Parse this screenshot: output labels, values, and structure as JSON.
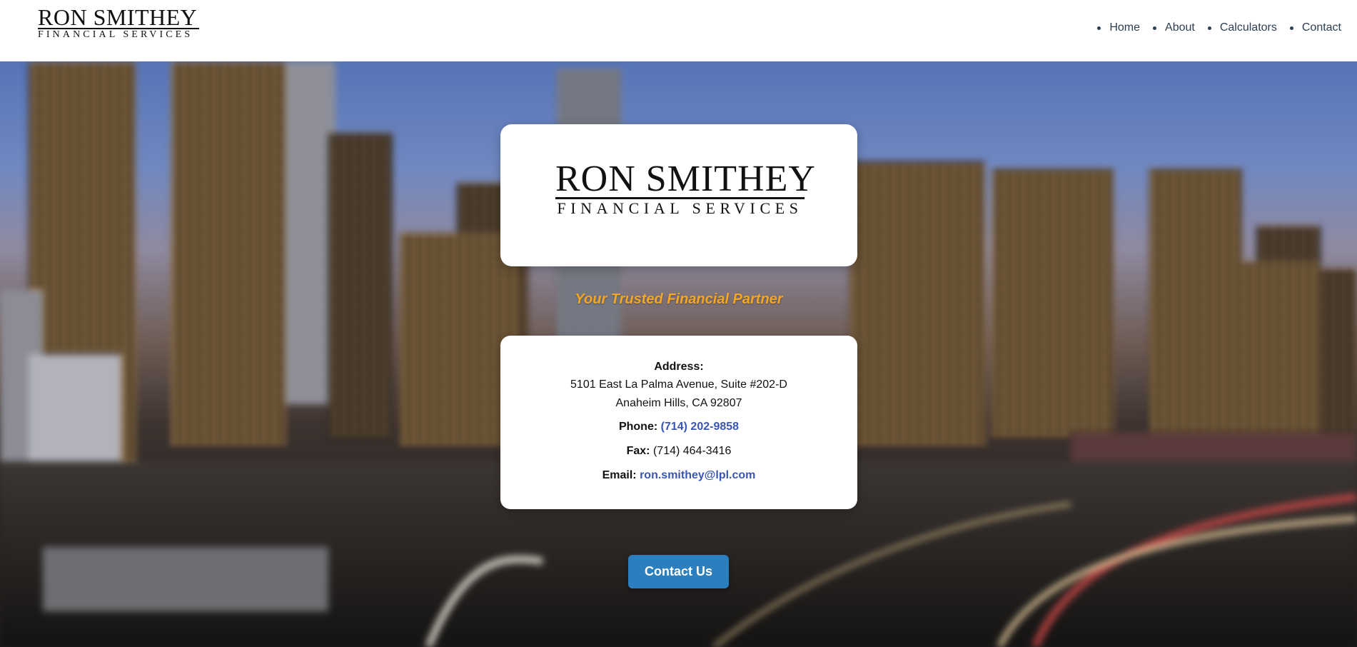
{
  "header": {
    "logo_name": "RON SMITHEY",
    "logo_sub": "FINANCIAL SERVICES"
  },
  "nav": {
    "items": [
      {
        "label": "Home"
      },
      {
        "label": "About"
      },
      {
        "label": "Calculators"
      },
      {
        "label": "Contact"
      }
    ]
  },
  "logo_card": {
    "logo_name": "RON SMITHEY",
    "logo_sub": "FINANCIAL SERVICES"
  },
  "tagline": "Your Trusted Financial Partner",
  "info": {
    "address_label": "Address:",
    "address_line1": "5101 East La Palma Avenue, Suite #202-D",
    "address_line2": "Anaheim Hills, CA 92807",
    "phone_label": "Phone:",
    "phone_value": "(714) 202-9858",
    "fax_label": "Fax:",
    "fax_value": "(714) 464-3416",
    "email_label": "Email:",
    "email_value": "ron.smithey@lpl.com"
  },
  "cta": {
    "label": "Contact Us"
  },
  "colors": {
    "accent_gold": "#f5a623",
    "link_blue": "#3a56b0",
    "button_blue": "#2b7fbf",
    "nav_text": "#2c3e50"
  }
}
